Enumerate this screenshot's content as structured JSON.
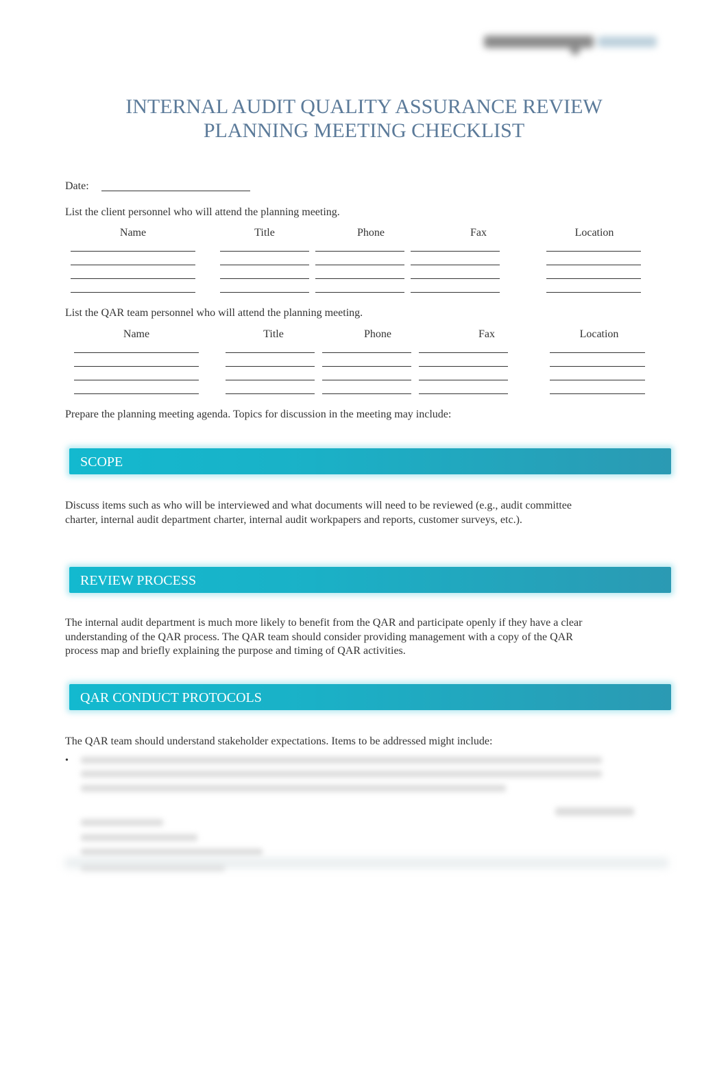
{
  "header": {
    "logo_icon": "brand-logo-icon"
  },
  "title": {
    "line1": "INTERNAL AUDIT QUALITY ASSURANCE REVIEW",
    "line2": "PLANNING MEETING CHECKLIST",
    "color": "#5b7a99"
  },
  "date": {
    "label": "Date:",
    "value": ""
  },
  "client_section": {
    "intro": "List the client personnel who will attend the planning meeting.",
    "columns": [
      "Name",
      "Title",
      "Phone",
      "Fax",
      "Location"
    ],
    "rows": [
      [
        "",
        "",
        "",
        "",
        ""
      ],
      [
        "",
        "",
        "",
        "",
        ""
      ],
      [
        "",
        "",
        "",
        "",
        ""
      ],
      [
        "",
        "",
        "",
        "",
        ""
      ]
    ]
  },
  "qar_section": {
    "intro": "List the QAR team personnel who will attend the planning meeting.",
    "columns": [
      "Name",
      "Title",
      "Phone",
      "Fax",
      "Location"
    ],
    "rows": [
      [
        "",
        "",
        "",
        "",
        ""
      ],
      [
        "",
        "",
        "",
        "",
        ""
      ],
      [
        "",
        "",
        "",
        "",
        ""
      ],
      [
        "",
        "",
        "",
        "",
        ""
      ]
    ]
  },
  "agenda_intro": "Prepare the planning meeting agenda. Topics for discussion in the meeting may include:",
  "sections": [
    {
      "heading": "SCOPE",
      "body": "Discuss items such as who will be interviewed and what documents will need to be reviewed (e.g., audit committee charter, internal audit department charter, internal audit workpapers and reports, customer surveys, etc.)."
    },
    {
      "heading": "REVIEW PROCESS",
      "body": "The internal audit department is much more likely to benefit from the QAR and participate openly if they have a clear understanding of the QAR process. The QAR team should consider providing management with a copy of the QAR process map and briefly explaining the purpose and timing of QAR activities."
    },
    {
      "heading": "QAR CONDUCT PROTOCOLS",
      "body": "The QAR team should understand stakeholder expectations. Items to be addressed might include:"
    }
  ],
  "bullet_symbol": "•",
  "colors": {
    "section_bar_start": "#13b9cf",
    "section_bar_end": "#2b9ab3",
    "body_text": "#333333"
  }
}
